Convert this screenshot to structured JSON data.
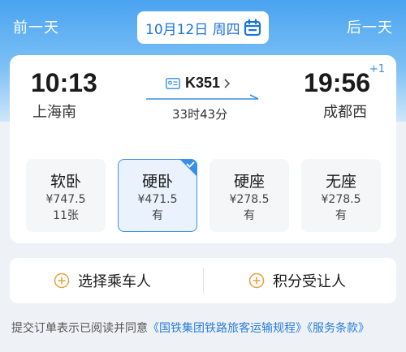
{
  "header": {
    "prev_day": "前一天",
    "next_day": "后一天",
    "date": "10月12日 周四"
  },
  "trip": {
    "departure_time": "10:13",
    "departure_station": "上海南",
    "arrival_time": "19:56",
    "arrival_day_offset": "+1",
    "arrival_station": "成都西",
    "train_number": "K351",
    "duration": "33时43分"
  },
  "seats": [
    {
      "type": "软卧",
      "price": "¥747.5",
      "availability": "11张",
      "selected": false
    },
    {
      "type": "硬卧",
      "price": "¥471.5",
      "availability": "有",
      "selected": true
    },
    {
      "type": "硬座",
      "price": "¥278.5",
      "availability": "有",
      "selected": false
    },
    {
      "type": "无座",
      "price": "¥278.5",
      "availability": "有",
      "selected": false
    }
  ],
  "actions": {
    "select_passenger": "选择乘车人",
    "points_transfer": "积分受让人"
  },
  "notice": {
    "prefix": "提交订单表示已阅读并同意",
    "link1": "《国铁集团铁路旅客运输规程》",
    "link2": "《服务条款》"
  },
  "colors": {
    "accent": "#3a8ee6",
    "header_gradient_top": "#4aa3f0"
  }
}
